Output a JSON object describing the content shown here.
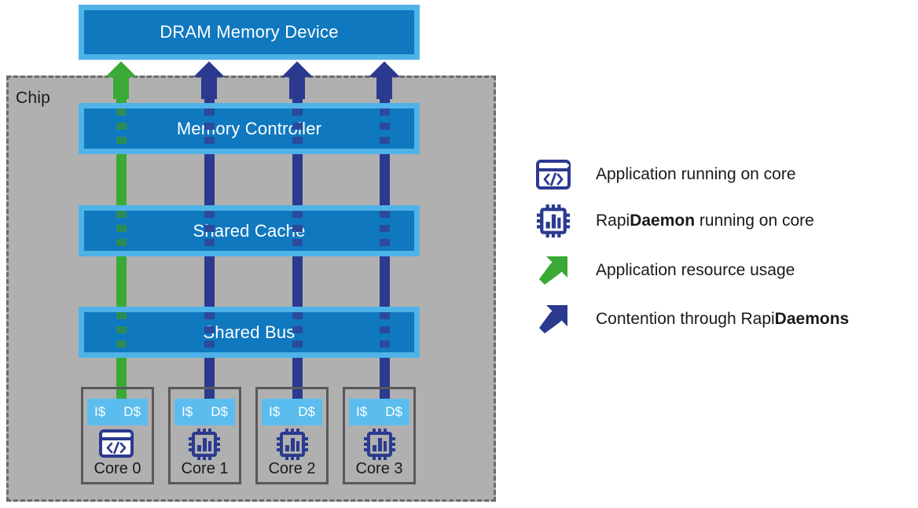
{
  "diagram": {
    "chip_label": "Chip",
    "blocks": [
      {
        "label": "DRAM Memory Device"
      },
      {
        "label": "Memory Controller"
      },
      {
        "label": "Shared Cache"
      },
      {
        "label": "Shared Bus"
      }
    ],
    "cores": [
      {
        "name": "Core 0",
        "icache": "I$",
        "dcache": "D$",
        "icon": "application-window-code-icon",
        "link": "green"
      },
      {
        "name": "Core 1",
        "icache": "I$",
        "dcache": "D$",
        "icon": "cpu-chip-icon",
        "link": "blue"
      },
      {
        "name": "Core 2",
        "icache": "I$",
        "dcache": "D$",
        "icon": "cpu-chip-icon",
        "link": "blue"
      },
      {
        "name": "Core 3",
        "icache": "I$",
        "dcache": "D$",
        "icon": "cpu-chip-icon",
        "link": "blue"
      }
    ]
  },
  "legend": {
    "items": [
      {
        "icon": "application-window-code-icon",
        "text_plain": "Application running on core",
        "text_prefix": "Application running on core",
        "text_bold": "",
        "text_suffix": ""
      },
      {
        "icon": "cpu-chip-icon",
        "text_plain": "RapiDaemon running on core",
        "text_prefix": "Rapi",
        "text_bold": "Daemon",
        "text_suffix": " running on core"
      },
      {
        "icon": "green-diagonal-arrow-icon",
        "text_plain": "Application resource usage",
        "text_prefix": "Application resource usage",
        "text_bold": "",
        "text_suffix": ""
      },
      {
        "icon": "blue-diagonal-arrow-icon",
        "text_plain": "Contention through RapiDaemons",
        "text_prefix": "Contention through Rapi",
        "text_bold": "Daemons",
        "text_suffix": ""
      }
    ]
  },
  "colors": {
    "block_fill": "#1078be",
    "block_frame": "#4fb3e8",
    "cache_fill": "#5bbdee",
    "chip_bg": "#b0b0b0",
    "chip_border": "#6b6b6b",
    "core_border": "#595959",
    "arrow_green": "#3ba935",
    "arrow_blue": "#2b3a8f",
    "text_dark": "#1a1a1a",
    "text_light": "#ffffff"
  }
}
